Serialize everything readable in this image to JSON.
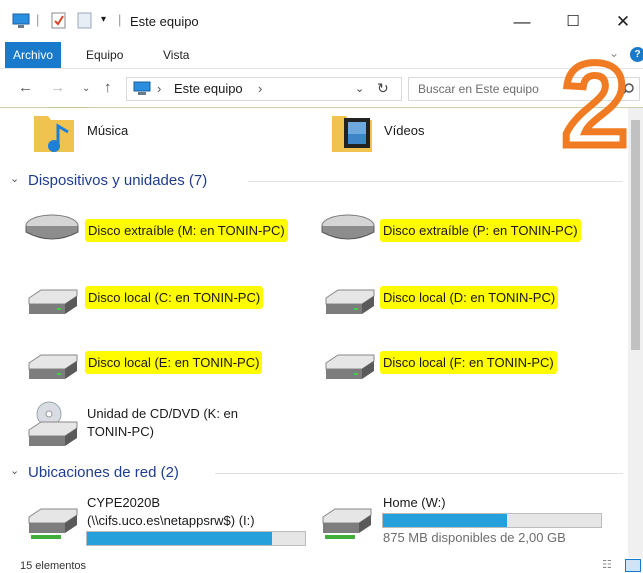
{
  "window": {
    "title": "Este equipo",
    "buttons": {
      "minimize": "—",
      "maximize": "☐",
      "close": "✕"
    }
  },
  "ribbon": {
    "tabs": [
      {
        "label": "Archivo",
        "active": true
      },
      {
        "label": "Equipo",
        "active": false
      },
      {
        "label": "Vista",
        "active": false
      }
    ]
  },
  "address": {
    "path_sep": "›",
    "path": "Este equipo",
    "search_placeholder": "Buscar en Este equipo"
  },
  "folders": [
    {
      "label": "Música",
      "icon": "music-folder-icon"
    },
    {
      "label": "Vídeos",
      "icon": "videos-folder-icon"
    }
  ],
  "devices": {
    "header": "Dispositivos y unidades (7)",
    "items": [
      {
        "label": "Disco extraíble (M: en TONIN-PC)",
        "icon": "removable-disk-icon",
        "highlight": true
      },
      {
        "label": "Disco extraíble (P: en TONIN-PC)",
        "icon": "removable-disk-icon",
        "highlight": true
      },
      {
        "label": "Disco local (C: en TONIN-PC)",
        "icon": "local-disk-icon",
        "highlight": true
      },
      {
        "label": "Disco local (D: en TONIN-PC)",
        "icon": "local-disk-icon",
        "highlight": true
      },
      {
        "label": "Disco local (E: en TONIN-PC)",
        "icon": "local-disk-icon",
        "highlight": true
      },
      {
        "label": "Disco local (F: en TONIN-PC)",
        "icon": "local-disk-icon",
        "highlight": true
      },
      {
        "label_line1": "Unidad de CD/DVD (K: en",
        "label_line2": "TONIN-PC)",
        "icon": "cd-dvd-drive-icon",
        "highlight": false
      }
    ]
  },
  "network": {
    "header": "Ubicaciones de red (2)",
    "items": [
      {
        "line1": "CYPE2020B",
        "line2": "(\\\\cifs.uco.es\\netappsrw$) (I:)",
        "usage": 0.85,
        "icon": "network-drive-icon"
      },
      {
        "line1": "Home (W:)",
        "line2": "875 MB disponibles de 2,00 GB",
        "usage": 0.57,
        "icon": "network-drive-icon"
      }
    ]
  },
  "status": {
    "count": "15 elementos"
  },
  "overlay": {
    "number": "2",
    "color": "#f07b22"
  },
  "colors": {
    "accent": "#1979ca",
    "highlight": "#fffb00",
    "bar": "#26a0da",
    "group_header": "#1e3d8f"
  }
}
